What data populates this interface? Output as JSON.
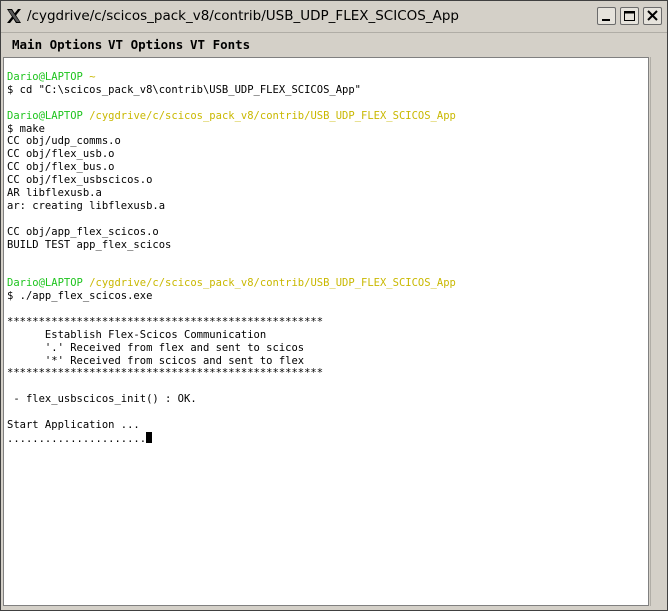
{
  "window": {
    "title": "/cygdrive/c/scicos_pack_v8/contrib/USB_UDP_FLEX_SCICOS_App",
    "icon": "x11-icon",
    "buttons": [
      "minimize-icon",
      "maximize-icon",
      "close-icon"
    ]
  },
  "menu": {
    "items": [
      "Main Options",
      "VT Options",
      "VT Fonts"
    ]
  },
  "terminal": {
    "colors": {
      "user": "#1ec41e",
      "path": "#c9b800",
      "text": "#000000"
    },
    "lines": [
      {
        "user": "Dario@LAPTOP",
        "path": "~",
        "text": ""
      },
      {
        "user": "",
        "path": "",
        "text": "$ cd \"C:\\scicos_pack_v8\\contrib\\USB_UDP_FLEX_SCICOS_App\""
      },
      {
        "user": "",
        "path": "",
        "text": ""
      },
      {
        "user": "Dario@LAPTOP",
        "path": "/cygdrive/c/scicos_pack_v8/contrib/USB_UDP_FLEX_SCICOS_App",
        "text": ""
      },
      {
        "user": "",
        "path": "",
        "text": "$ make"
      },
      {
        "user": "",
        "path": "",
        "text": "CC obj/udp_comms.o"
      },
      {
        "user": "",
        "path": "",
        "text": "CC obj/flex_usb.o"
      },
      {
        "user": "",
        "path": "",
        "text": "CC obj/flex_bus.o"
      },
      {
        "user": "",
        "path": "",
        "text": "CC obj/flex_usbscicos.o"
      },
      {
        "user": "",
        "path": "",
        "text": "AR libflexusb.a"
      },
      {
        "user": "",
        "path": "",
        "text": "ar: creating libflexusb.a"
      },
      {
        "user": "",
        "path": "",
        "text": ""
      },
      {
        "user": "",
        "path": "",
        "text": "CC obj/app_flex_scicos.o"
      },
      {
        "user": "",
        "path": "",
        "text": "BUILD TEST app_flex_scicos"
      },
      {
        "user": "",
        "path": "",
        "text": ""
      },
      {
        "user": "",
        "path": "",
        "text": ""
      },
      {
        "user": "Dario@LAPTOP",
        "path": "/cygdrive/c/scicos_pack_v8/contrib/USB_UDP_FLEX_SCICOS_App",
        "text": ""
      },
      {
        "user": "",
        "path": "",
        "text": "$ ./app_flex_scicos.exe"
      },
      {
        "user": "",
        "path": "",
        "text": ""
      },
      {
        "user": "",
        "path": "",
        "text": "**************************************************"
      },
      {
        "user": "",
        "path": "",
        "text": "      Establish Flex-Scicos Communication"
      },
      {
        "user": "",
        "path": "",
        "text": "      '.' Received from flex and sent to scicos"
      },
      {
        "user": "",
        "path": "",
        "text": "      '*' Received from scicos and sent to flex"
      },
      {
        "user": "",
        "path": "",
        "text": "**************************************************"
      },
      {
        "user": "",
        "path": "",
        "text": ""
      },
      {
        "user": "",
        "path": "",
        "text": " - flex_usbscicos_init() : OK."
      },
      {
        "user": "",
        "path": "",
        "text": ""
      },
      {
        "user": "",
        "path": "",
        "text": "Start Application ..."
      },
      {
        "user": "",
        "path": "",
        "text": "......................",
        "cursor": true
      }
    ]
  }
}
